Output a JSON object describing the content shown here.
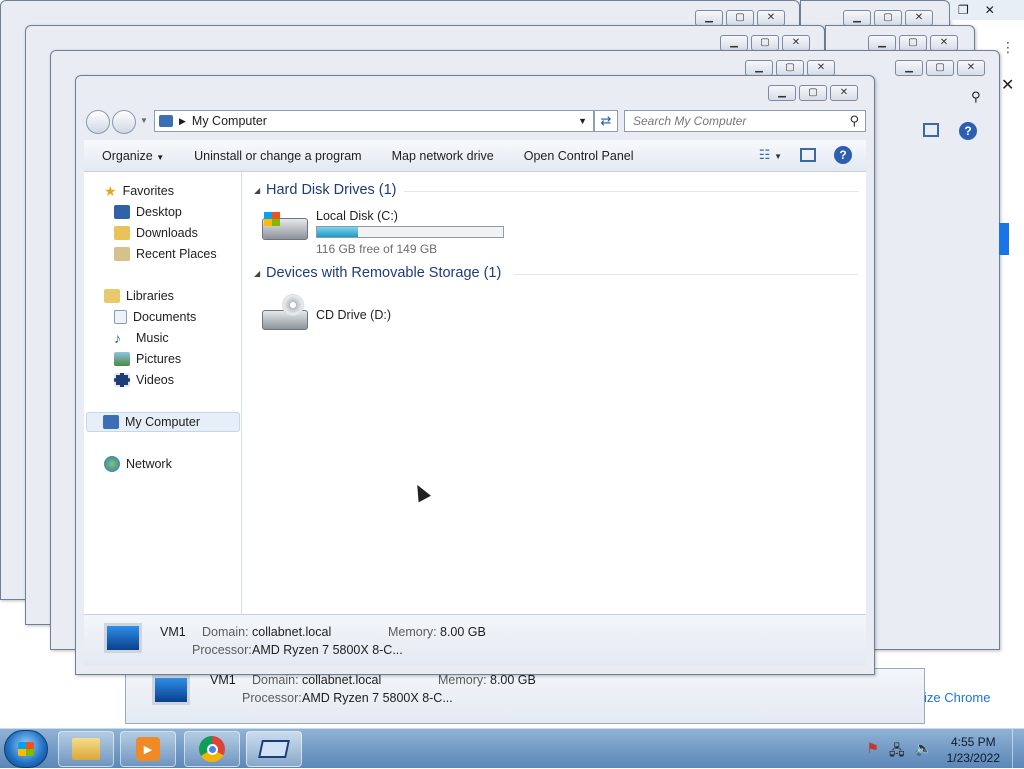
{
  "window": {
    "address": "My Computer",
    "search_placeholder": "Search My Computer",
    "toolbar": {
      "organize": "Organize",
      "uninstall": "Uninstall or change a program",
      "map_drive": "Map network drive",
      "control_panel": "Open Control Panel"
    }
  },
  "nav": {
    "favorites": "Favorites",
    "desktop": "Desktop",
    "downloads": "Downloads",
    "recent": "Recent Places",
    "libraries": "Libraries",
    "documents": "Documents",
    "music": "Music",
    "pictures": "Pictures",
    "videos": "Videos",
    "my_computer": "My Computer",
    "network": "Network"
  },
  "groups": {
    "hdd_title": "Hard Disk Drives (1)",
    "removable_title": "Devices with Removable Storage (1)"
  },
  "drives": {
    "c_label": "Local Disk (C:)",
    "c_free": "116 GB free of 149 GB",
    "c_used_fraction": 0.22,
    "d_label": "CD Drive (D:)"
  },
  "details": {
    "name": "VM1",
    "domain_label": "Domain:",
    "domain": "collabnet.local",
    "memory_label": "Memory:",
    "memory": "8.00 GB",
    "processor_label": "Processor:",
    "processor": "AMD Ryzen 7 5800X 8-C..."
  },
  "chrome_hint": "ize Chrome",
  "clock": {
    "time": "4:55 PM",
    "date": "1/23/2022"
  },
  "colors": {
    "accent": "#1e3c78",
    "taskbar": "#6f98c4"
  }
}
